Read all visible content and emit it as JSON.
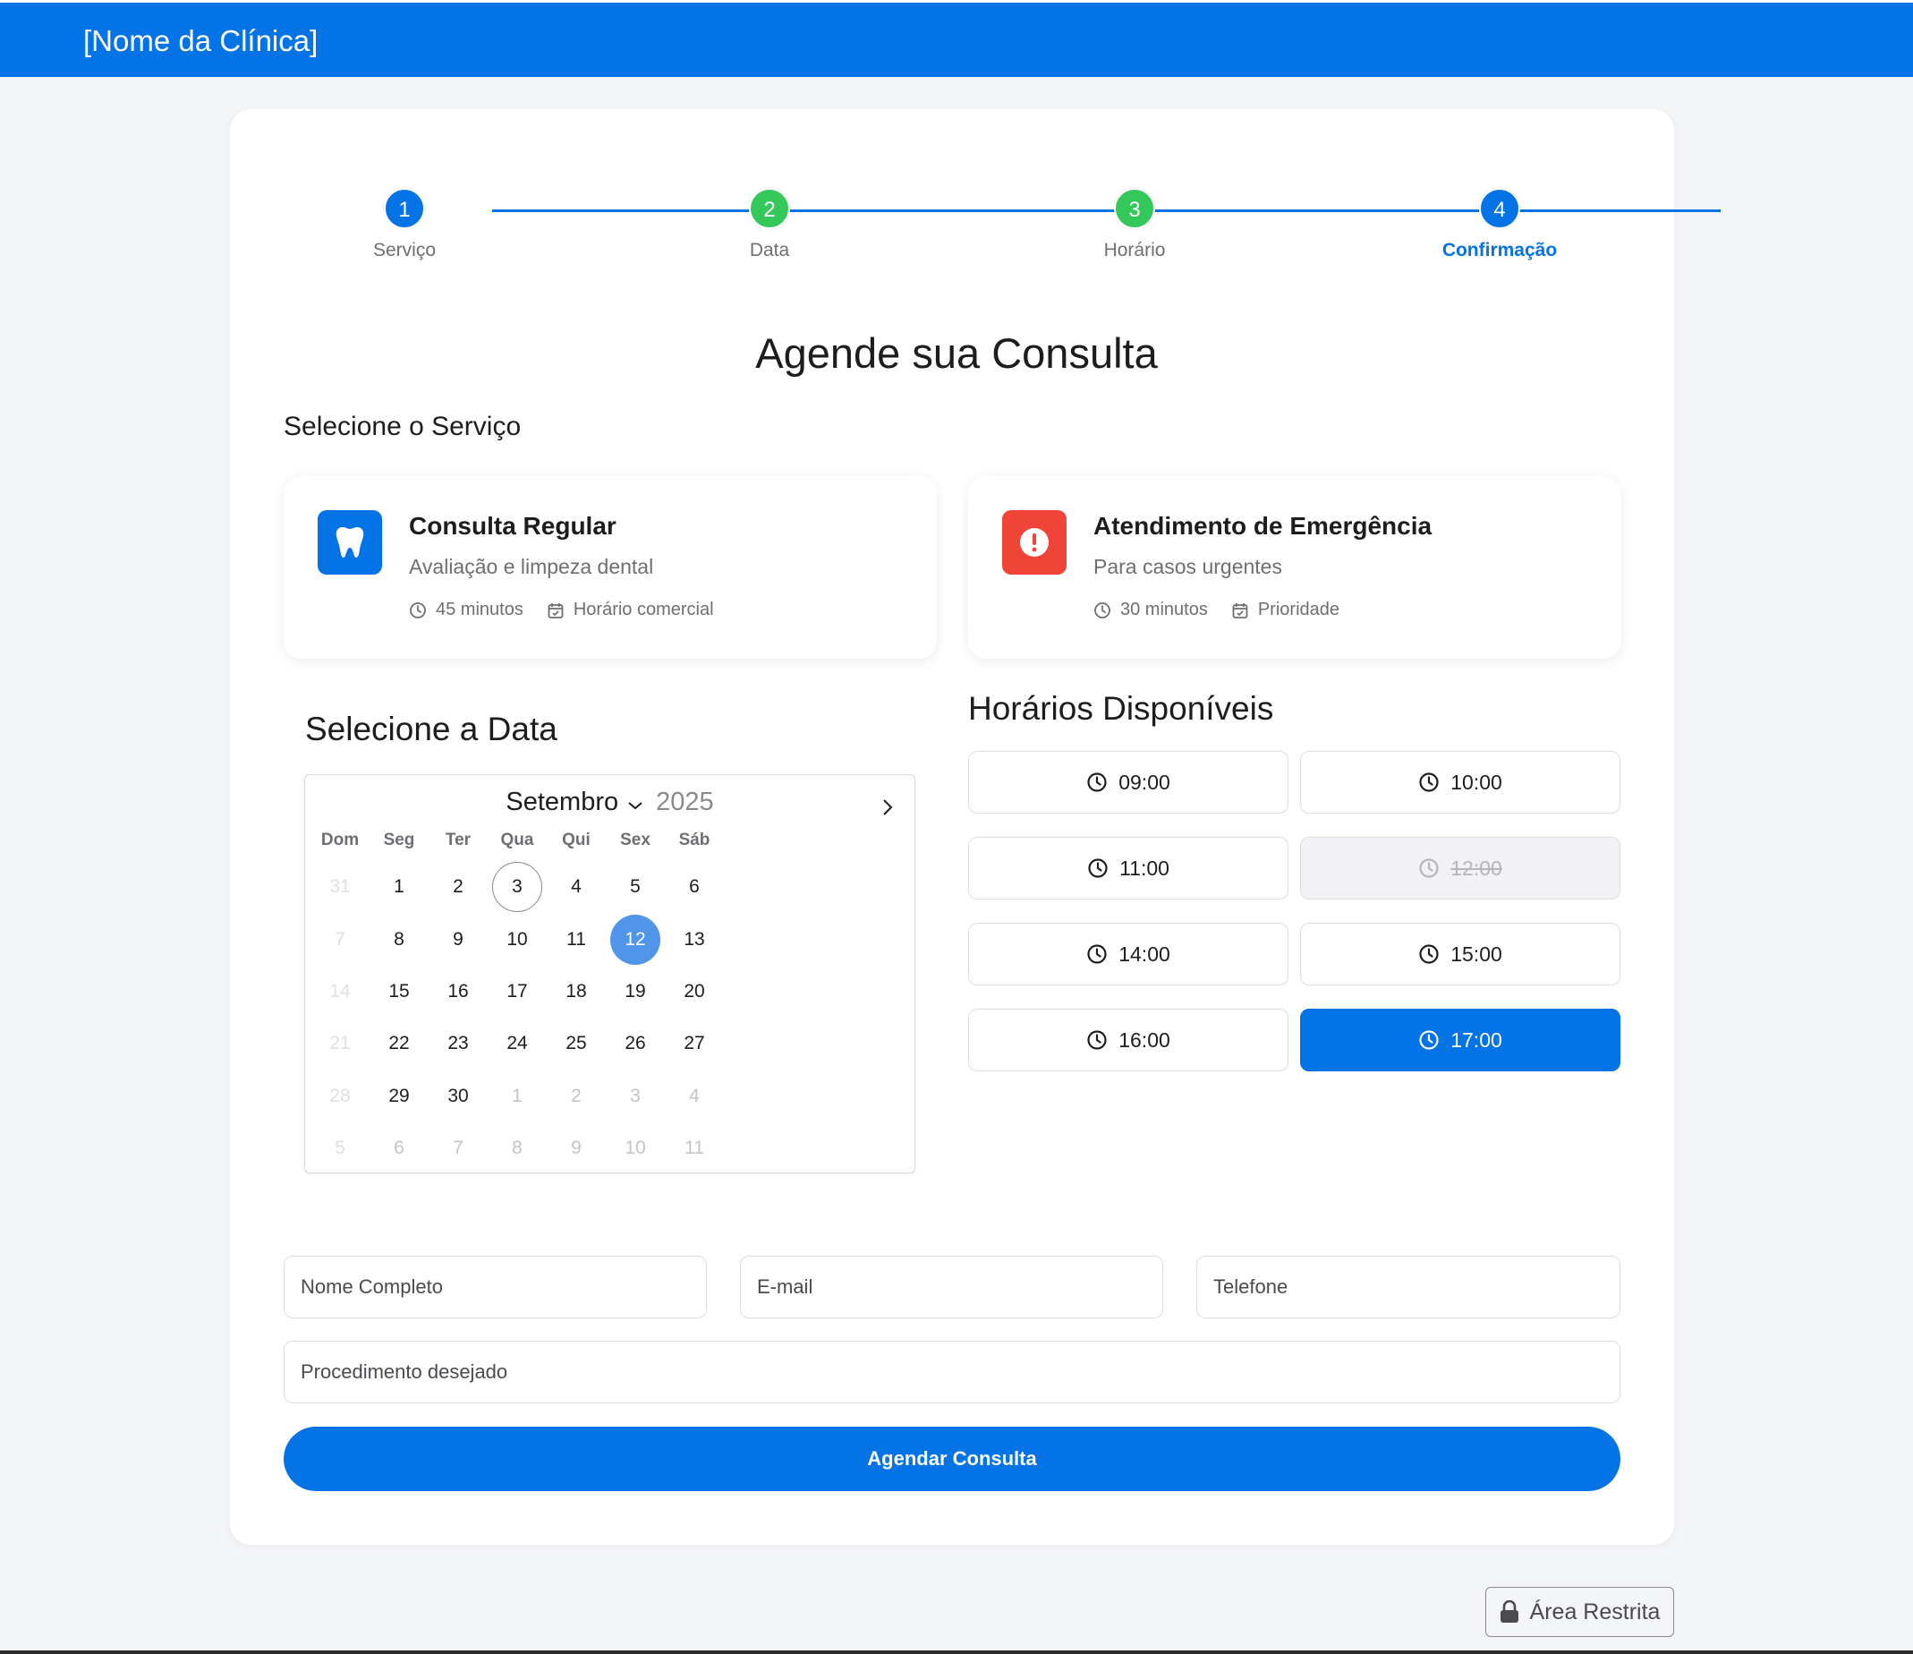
{
  "header": {
    "brand": "[Nome da Clínica]"
  },
  "colors": {
    "primary": "#0473e6",
    "success": "#34c759",
    "danger": "#ff3b30",
    "selected_day": "#4f95ea"
  },
  "stepper": [
    {
      "number": "1",
      "label": "Serviço",
      "state": "current"
    },
    {
      "number": "2",
      "label": "Data",
      "state": "done"
    },
    {
      "number": "3",
      "label": "Horário",
      "state": "done"
    },
    {
      "number": "4",
      "label": "Confirmação",
      "state": "active"
    }
  ],
  "page_title": "Agende sua Consulta",
  "services_section": {
    "title": "Selecione o Serviço",
    "items": [
      {
        "icon": "tooth-icon",
        "name": "Consulta Regular",
        "description": "Avaliação e limpeza dental",
        "duration": "45 minutos",
        "availability": "Horário comercial"
      },
      {
        "icon": "alert-icon",
        "name": "Atendimento de Emergência",
        "description": "Para casos urgentes",
        "duration": "30 minutos",
        "availability": "Prioridade"
      }
    ]
  },
  "date_section": {
    "title": "Selecione a Data",
    "month": "Setembro",
    "year": "2025",
    "weekdays": [
      "Dom",
      "Seg",
      "Ter",
      "Qua",
      "Qui",
      "Sex",
      "Sáb"
    ],
    "days": [
      [
        "31",
        "1",
        "2",
        "3",
        "4",
        "5",
        "6"
      ],
      [
        "7",
        "8",
        "9",
        "10",
        "11",
        "12",
        "13"
      ],
      [
        "14",
        "15",
        "16",
        "17",
        "18",
        "19",
        "20"
      ],
      [
        "21",
        "22",
        "23",
        "24",
        "25",
        "26",
        "27"
      ],
      [
        "28",
        "29",
        "30",
        "1",
        "2",
        "3",
        "4"
      ],
      [
        "5",
        "6",
        "7",
        "8",
        "9",
        "10",
        "11"
      ]
    ],
    "today": "3",
    "selected": "12"
  },
  "time_section": {
    "title": "Horários Disponíveis",
    "slots": [
      {
        "time": "09:00",
        "state": "available"
      },
      {
        "time": "10:00",
        "state": "available"
      },
      {
        "time": "11:00",
        "state": "available"
      },
      {
        "time": "12:00",
        "state": "unavailable"
      },
      {
        "time": "14:00",
        "state": "available"
      },
      {
        "time": "15:00",
        "state": "available"
      },
      {
        "time": "16:00",
        "state": "available"
      },
      {
        "time": "17:00",
        "state": "selected"
      }
    ]
  },
  "form": {
    "name_placeholder": "Nome Completo",
    "email_placeholder": "E-mail",
    "phone_placeholder": "Telefone",
    "procedure_placeholder": "Procedimento desejado",
    "submit_label": "Agendar Consulta"
  },
  "footer": {
    "restricted_label": "Área Restrita"
  }
}
